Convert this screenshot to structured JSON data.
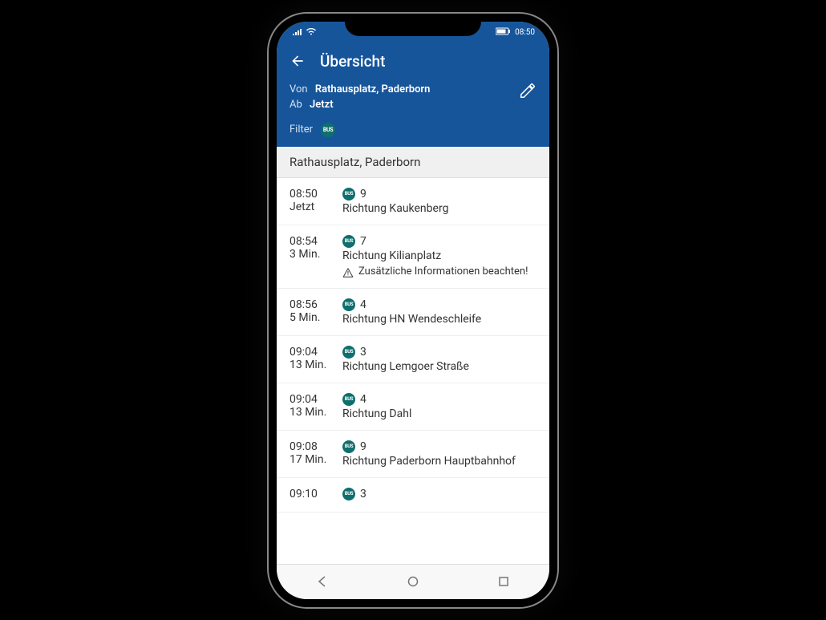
{
  "status": {
    "time": "08:50",
    "battery_icon": "battery",
    "wifi_icon": "wifi",
    "signal_icon": "signal"
  },
  "header": {
    "title": "Übersicht",
    "from_label": "Von",
    "from_value": "Rathausplatz, Paderborn",
    "dep_label": "Ab",
    "dep_value": "Jetzt",
    "filter_label": "Filter",
    "filter_badge": "BUS"
  },
  "section": {
    "stop_name": "Rathausplatz, Paderborn"
  },
  "departures": [
    {
      "time": "08:50",
      "rel": "Jetzt",
      "line": "9",
      "dest": "Richtung Kaukenberg",
      "alert": null
    },
    {
      "time": "08:54",
      "rel": "3 Min.",
      "line": "7",
      "dest": "Richtung Kilianplatz",
      "alert": "Zusätzliche Informationen beachten!"
    },
    {
      "time": "08:56",
      "rel": "5 Min.",
      "line": "4",
      "dest": "Richtung HN Wendeschleife",
      "alert": null
    },
    {
      "time": "09:04",
      "rel": "13 Min.",
      "line": "3",
      "dest": "Richtung Lemgoer Straße",
      "alert": null
    },
    {
      "time": "09:04",
      "rel": "13 Min.",
      "line": "4",
      "dest": "Richtung Dahl",
      "alert": null
    },
    {
      "time": "09:08",
      "rel": "17 Min.",
      "line": "9",
      "dest": "Richtung Paderborn Hauptbahnhof",
      "alert": null
    },
    {
      "time": "09:10",
      "rel": "",
      "line": "3",
      "dest": "",
      "alert": null
    }
  ],
  "transport_badge_text": "BUS",
  "colors": {
    "header_bg": "#17559a",
    "bus_badge": "#0f6e6e"
  }
}
